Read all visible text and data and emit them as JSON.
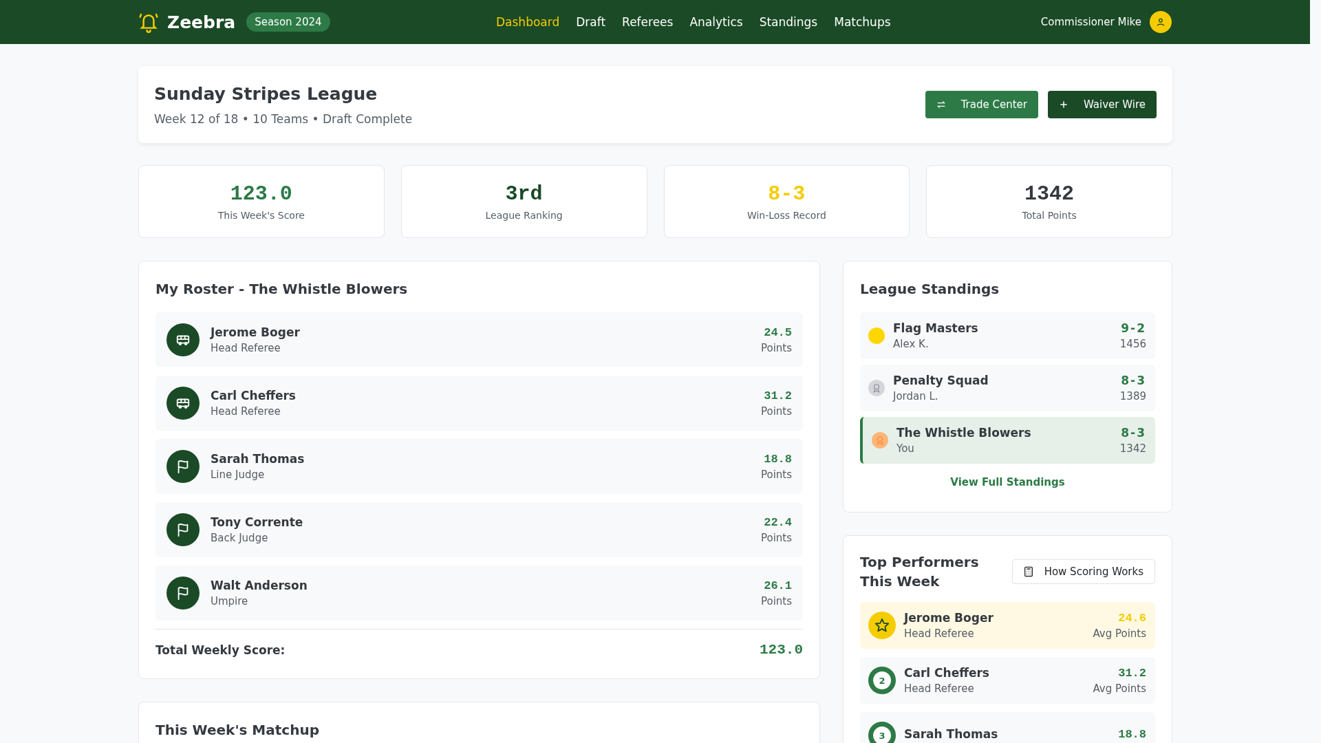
{
  "header": {
    "brand": "Zeebra",
    "season": "Season 2024",
    "nav": [
      {
        "label": "Dashboard",
        "selected": true
      },
      {
        "label": "Draft",
        "selected": false
      },
      {
        "label": "Referees",
        "selected": false
      },
      {
        "label": "Analytics",
        "selected": false
      },
      {
        "label": "Standings",
        "selected": false
      },
      {
        "label": "Matchups",
        "selected": false
      }
    ],
    "user": "Commissioner Mike"
  },
  "league": {
    "title": "Sunday Stripes League",
    "subtitle": "Week 12 of 18 • 10 Teams • Draft Complete",
    "buttons": [
      {
        "label": "Trade Center",
        "kind": "trade"
      },
      {
        "label": "Waiver Wire",
        "kind": "add"
      }
    ]
  },
  "stats": [
    {
      "value": "123.0",
      "label": "This Week's Score",
      "color": "#2d7a46"
    },
    {
      "value": "3rd",
      "label": "League Ranking",
      "color": "#1a4a26"
    },
    {
      "value": "8-3",
      "label": "Win-Loss Record",
      "color": "#f5cc00"
    },
    {
      "value": "1342",
      "label": "Total Points",
      "color": "#343a40"
    }
  ],
  "roster": {
    "title": "My Roster - The Whistle Blowers",
    "players": [
      {
        "name": "Jerome Boger",
        "position": "Head Referee",
        "points": "24.5",
        "unit": "Points",
        "kind": "head"
      },
      {
        "name": "Carl Cheffers",
        "position": "Head Referee",
        "points": "31.2",
        "unit": "Points",
        "kind": "head"
      },
      {
        "name": "Sarah Thomas",
        "position": "Line Judge",
        "points": "18.8",
        "unit": "Points",
        "kind": "field"
      },
      {
        "name": "Tony Corrente",
        "position": "Back Judge",
        "points": "22.4",
        "unit": "Points",
        "kind": "field"
      },
      {
        "name": "Walt Anderson",
        "position": "Umpire",
        "points": "26.1",
        "unit": "Points",
        "kind": "field"
      }
    ],
    "total_label": "Total Weekly Score:",
    "total": "123.0"
  },
  "matchup": {
    "title": "This Week's Matchup"
  },
  "standings": {
    "title": "League Standings",
    "teams": [
      {
        "name": "Flag Masters",
        "owner": "Alex K.",
        "record": "9-2",
        "points": "1456",
        "kind": "gold",
        "current": false
      },
      {
        "name": "Penalty Squad",
        "owner": "Jordan L.",
        "record": "8-3",
        "points": "1389",
        "kind": "silver",
        "current": false
      },
      {
        "name": "The Whistle Blowers",
        "owner": "You",
        "record": "8-3",
        "points": "1342",
        "kind": "bronze",
        "current": true
      }
    ],
    "link": "View Full Standings"
  },
  "performers": {
    "title": "Top Performers This Week",
    "button": "How Scoring Works",
    "players": [
      {
        "name": "Jerome Boger",
        "position": "Head Referee",
        "points": "24.6",
        "unit": "Avg Points",
        "kind": "star"
      },
      {
        "name": "Carl Cheffers",
        "position": "Head Referee",
        "points": "31.2",
        "unit": "Avg Points",
        "kind": "rank",
        "rank": "2"
      },
      {
        "name": "Sarah Thomas",
        "points": "18.8",
        "kind": "rank",
        "rank": "3"
      }
    ]
  }
}
